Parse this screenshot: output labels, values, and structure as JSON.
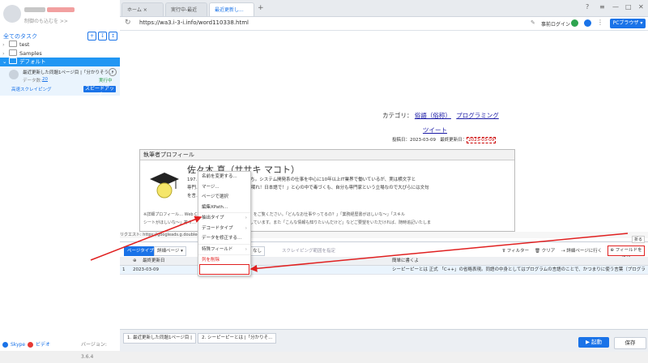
{
  "sidebar": {
    "login_hint": "制御のも込むを >>",
    "all_tasks": "全てのタスク",
    "tree": [
      "test",
      "Samples",
      "デフォルト"
    ],
    "task": {
      "title": "最近更新した同題1ページ目 |「分かりそう...",
      "data_label": "データ数:",
      "data_count": "20",
      "status": "実行中",
      "mode": "高速スクレイピング",
      "speedup": "スピードアップ"
    },
    "footer": {
      "skype": "Skype",
      "video": "ビデオ",
      "version": "バージョン: 3.6.4"
    }
  },
  "tabs": [
    "ホーム",
    "実行中-最近",
    "最近更新し..."
  ],
  "url": "https://wa3.i-3-i.info/word110338.html",
  "toolbar": {
    "login": "事前ログイン",
    "browser": "PCブラウザ"
  },
  "page": {
    "category_label": "カテゴリ：",
    "category_links": [
      "俗語（俗称）",
      "プログラミング"
    ],
    "tweet": "ツイート",
    "posted": "投稿日：2023-03-09",
    "updated_label": "最終更新日：",
    "updated": "2023-03-09",
    "profile_header": "執筆者プロフィール",
    "author": "佐々木 真（ササキ マコト）",
    "bio1": "197… イギリス生まれの日本育ち。システム開発系の仕事を中心に10年以上IT業界で働いているが、実は横文字と",
    "bio2": "専門… すぎるときは「日本語で喋れ！日本語で！」と心の中で毒づくも、自分も専門家という立場なので大ぴらには文句",
    "bio3": "を言…",
    "bio4": "※詳細プロフィール… Web Create Service」Webサイト】をご覧ください。「どんなお仕事やってるの？」「業務経歴書がほしいな～」「スキル",
    "bio5": "シートがほしいな～」等々… プロフィールはすべてを公開しています。また「こんな情報も知りたいんだけど」などご要望をいただければ、随時追記いたしま",
    "request": "リクエスト: https://googleads.g.doubleclick... ub-463059567..."
  },
  "context_menu": [
    "名前を変更する...",
    "マージ...",
    "ページで選択",
    "編集XPath...",
    "抽出タイプ",
    "デコードタイプ",
    "データを修正する...",
    "特殊フィールド",
    "列を削除"
  ],
  "panel": {
    "page_type": "ページタイプ",
    "detail_page": "詳細ページ",
    "right_btns": [
      "フィルター",
      "クリア",
      "詳細ページに行く"
    ],
    "add_field": "フィールドを追加",
    "columns": [
      "最終更新日",
      "",
      "簡単に書くよ"
    ],
    "rows": [
      {
        "idx": "1",
        "date": "2023-03-09",
        "text": "シーピーピーとは 正式 「C++」の省略表現。同語の中身としてはプログラムの言語のことで、かつまりに使う言葉（プログラミング言語）のひと..."
      }
    ],
    "scrape_hint": "スクレイピング範囲を指定",
    "collapse": "折る",
    "none": "なし"
  },
  "bottom": {
    "tabs": [
      "1. 最近更新した同題1ページ目 |",
      "2. シーピーピーとは |「分かりそ..."
    ],
    "start": "起動",
    "save": "保存"
  },
  "colors": {
    "accent": "#1a73e8",
    "highlight": "#e02020"
  }
}
